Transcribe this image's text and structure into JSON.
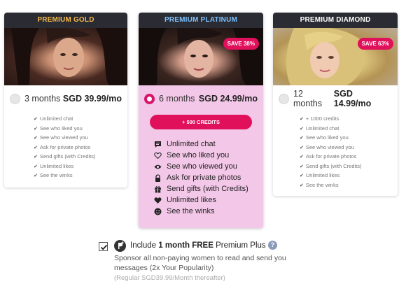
{
  "plans": [
    {
      "name": "PREMIUM GOLD",
      "months": "3 months",
      "price": "SGD 39.99/mo",
      "selected": false,
      "features": [
        "Unlimited chat",
        "See who liked you",
        "See who viewed you",
        "Ask for private photos",
        "Send gifts (with Credits)",
        "Unlimited likes",
        "See the winks"
      ]
    },
    {
      "name": "PREMIUM PLATINUM",
      "badge": "SAVE 38%",
      "months": "6 months",
      "price": "SGD 24.99/mo",
      "selected": true,
      "credits_button": "+ 500 CREDITS",
      "features": [
        {
          "icon": "chat-icon",
          "label": "Unlimited chat"
        },
        {
          "icon": "heart-outline-icon",
          "label": "See who liked you"
        },
        {
          "icon": "eye-icon",
          "label": "See who viewed you"
        },
        {
          "icon": "lock-icon",
          "label": "Ask for private photos"
        },
        {
          "icon": "gift-icon",
          "label": "Send gifts (with Credits)"
        },
        {
          "icon": "heart-icon",
          "label": "Unlimited likes"
        },
        {
          "icon": "wink-icon",
          "label": "See the winks"
        }
      ]
    },
    {
      "name": "PREMIUM DIAMOND",
      "badge": "SAVE 63%",
      "months": "12 months",
      "price": "SGD 14.99/mo",
      "selected": false,
      "features": [
        "+ 1000 credits",
        "Unlimited chat",
        "See who liked you",
        "See who viewed you",
        "Ask for private photos",
        "Send gifts (with Credits)",
        "Unlimited likes",
        "See the winks"
      ]
    }
  ],
  "include": {
    "checked": true,
    "icon": "premium-plus-icon",
    "title_prefix": "Include ",
    "title_bold": "1 month FREE",
    "title_suffix": " Premium Plus",
    "description": "Sponsor all non-paying women to read and send you messages (2x Your Popularity)",
    "note": "(Regular SGD39.99/Month thereafter)"
  },
  "colors": {
    "accent": "#e0105a",
    "gold": "#f2b84a",
    "platinum": "#7cc1ff",
    "platinum_card_bg": "#f3c7e8",
    "header_bg": "#2b2b33"
  }
}
